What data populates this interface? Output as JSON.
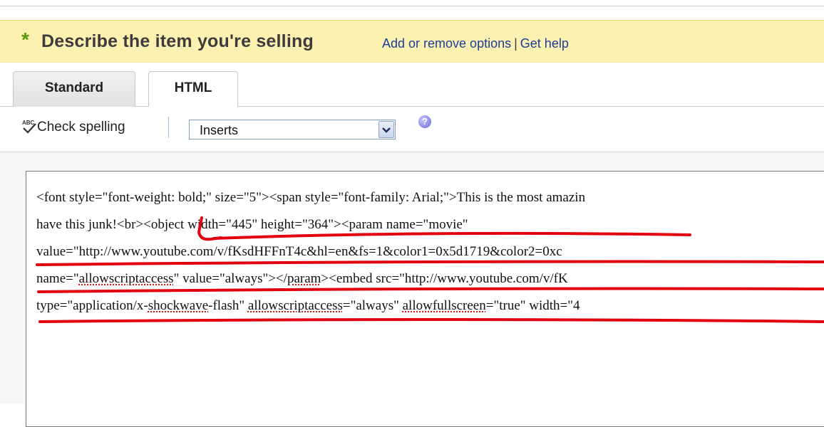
{
  "section": {
    "required_star": "*",
    "title": "Describe the item you're selling",
    "link_options": "Add or remove options",
    "link_separator": "|",
    "link_help": "Get help"
  },
  "tabs": [
    {
      "label": "Standard",
      "active": false
    },
    {
      "label": "HTML",
      "active": true
    }
  ],
  "toolbar": {
    "spell_label": "Check spelling",
    "spell_icon": "abc-check-icon",
    "inserts_selected": "Inserts",
    "help_icon": "question-icon"
  },
  "editor": {
    "lines": [
      [
        "<font style=\"font-weight: bold;\" size=\"5\"><span style=\"font-family: Arial;\">This is the most amazin"
      ],
      [
        "have this junk!<br><object width=\"445\" height=\"364\"><param name=\"movie\""
      ],
      [
        "value=\"http://www.youtube.com/v/fKsdHFFnT4c&hl=en&fs=1&color1=0x5d1719&color2=0xc"
      ],
      [
        "name=\"",
        "allowscriptaccess",
        "\" value=\"always\"></",
        "param",
        "><embed src=\"http://www.youtube.com/v/fK"
      ],
      [
        "type=\"application/x-",
        "shockwave",
        "-flash\" ",
        "allowscriptaccess",
        "=\"always\" ",
        "allowfullscreen",
        "=\"true\" width=\"4"
      ]
    ]
  },
  "colors": {
    "header_bg": "#fdf1b2",
    "star_green": "#5a9a0e",
    "link_blue": "#1c3d9c",
    "markup_red": "#e0000f"
  }
}
